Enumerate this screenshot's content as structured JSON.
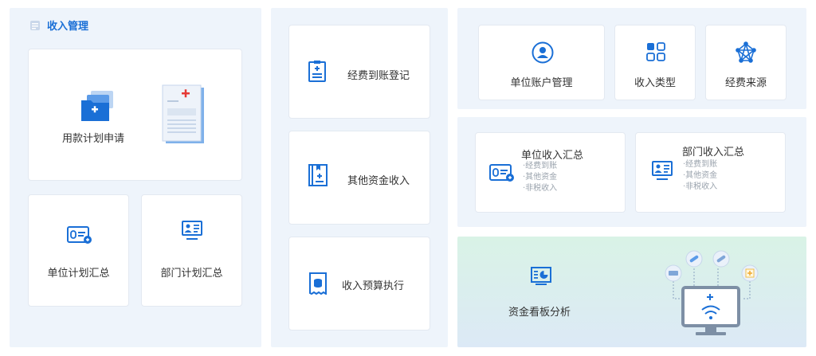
{
  "header": {
    "title": "收入管理",
    "title_icon": "database-icon"
  },
  "left": {
    "apply": {
      "label": "用款计划申请",
      "icon": "folder-plus-icon"
    },
    "unit_plan": {
      "label": "单位计划汇总",
      "icon": "id-card-icon"
    },
    "dept_plan": {
      "label": "部门计划汇总",
      "icon": "monitor-user-icon"
    }
  },
  "middle": {
    "arrival": {
      "label": "经费到账登记",
      "icon": "clipboard-plus-icon"
    },
    "other": {
      "label": "其他资金收入",
      "icon": "book-plus-icon"
    },
    "budget": {
      "label": "收入预算执行",
      "icon": "receipt-coin-icon"
    }
  },
  "right": {
    "account": {
      "label": "单位账户管理",
      "icon": "user-circle-icon"
    },
    "types": {
      "label": "收入类型",
      "icon": "grid-icon"
    },
    "sources": {
      "label": "经费来源",
      "icon": "network-icon"
    },
    "unit_summary": {
      "label": "单位收入汇总",
      "items": [
        "·经费到账",
        "·其他资金",
        "·非税收入"
      ]
    },
    "dept_summary": {
      "label": "部门收入汇总",
      "items": [
        "·经费到账",
        "·其他资金",
        "·非税收入"
      ]
    },
    "dashboard": {
      "label": "资金看板分析",
      "icon": "chart-board-icon"
    }
  },
  "colors": {
    "accent": "#1a6fd6",
    "panel": "#eef4fb",
    "card_border": "#e3e9f1"
  }
}
